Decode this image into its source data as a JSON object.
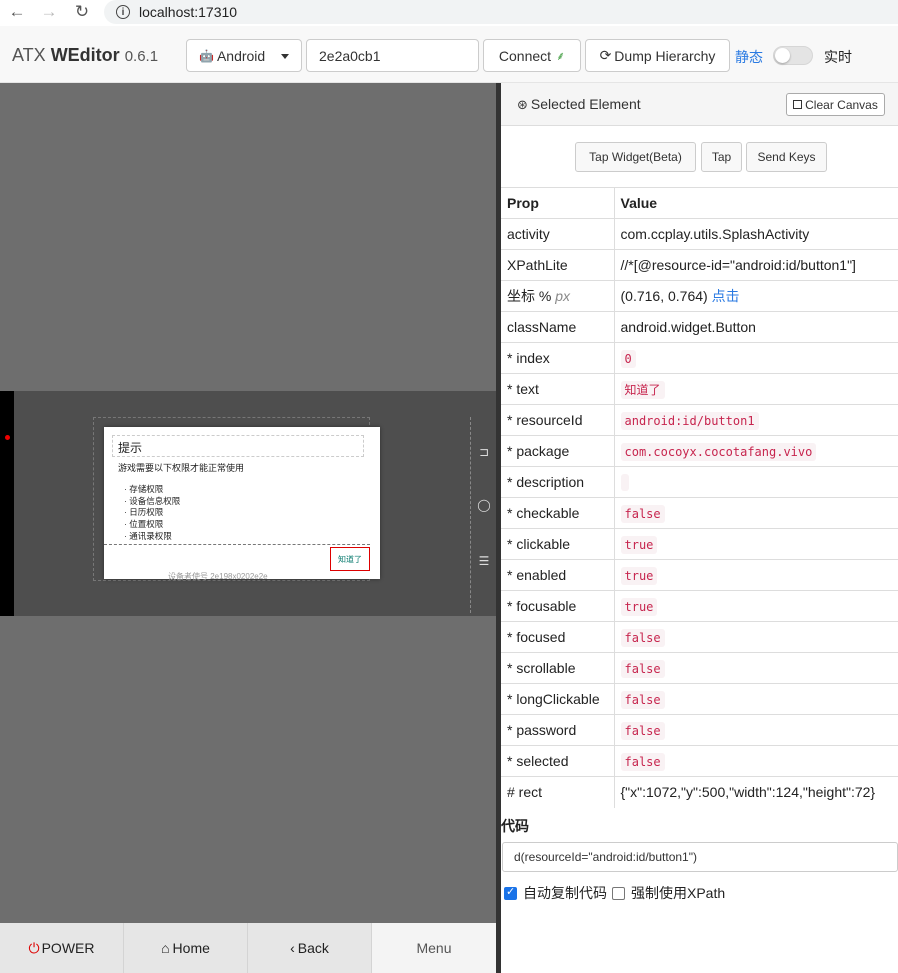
{
  "browser": {
    "url": "localhost:17310"
  },
  "header": {
    "brand_name": "ATX",
    "brand_bold": "WEditor",
    "version": "0.6.1",
    "platform": "Android",
    "serial": "2e2a0cb1",
    "connect_label": "Connect",
    "dump_label": "Dump Hierarchy",
    "static_label": "静态",
    "live_label": "实时"
  },
  "device": {
    "dialog_title": "提示",
    "dialog_message": "游戏需要以下权限才能正常使用",
    "permissions": [
      "存储权限",
      "设备信息权限",
      "日历权限",
      "位置权限",
      "通讯录权限"
    ],
    "ok_label": "知道了",
    "overlay_text": "设备者使号    2e198x0202e2e"
  },
  "bottom_bar": {
    "power": "POWER",
    "home": "Home",
    "back": "Back",
    "menu": "Menu"
  },
  "panel": {
    "title": "Selected Element",
    "clear_canvas": "Clear Canvas",
    "tap_widget": "Tap Widget(Beta)",
    "tap": "Tap",
    "send_keys": "Send Keys",
    "col_prop": "Prop",
    "col_value": "Value",
    "rows": [
      {
        "k": "activity",
        "v": "com.ccplay.utils.SplashActivity"
      },
      {
        "k": "XPathLite",
        "v": "//*[@resource-id=\"android:id/button1\"]"
      },
      {
        "k": "坐标 %",
        "k_suffix": "px",
        "v": "(0.716, 0.764)",
        "v_link": "点击"
      },
      {
        "k": "className",
        "v": "android.widget.Button"
      },
      {
        "k": "* index",
        "v": "0"
      },
      {
        "k": "* text",
        "v": "知道了"
      },
      {
        "k": "* resourceId",
        "v": "android:id/button1"
      },
      {
        "k": "* package",
        "v": "com.cocoyx.cocotafang.vivo"
      },
      {
        "k": "* description",
        "v": ""
      },
      {
        "k": "* checkable",
        "v": "false"
      },
      {
        "k": "* clickable",
        "v": "true"
      },
      {
        "k": "* enabled",
        "v": "true"
      },
      {
        "k": "* focusable",
        "v": "true"
      },
      {
        "k": "* focused",
        "v": "false"
      },
      {
        "k": "* scrollable",
        "v": "false"
      },
      {
        "k": "* longClickable",
        "v": "false"
      },
      {
        "k": "* password",
        "v": "false"
      },
      {
        "k": "* selected",
        "v": "false"
      },
      {
        "k": "# rect",
        "v": "{\"x\":1072,\"y\":500,\"width\":124,\"height\":72}"
      }
    ],
    "code_label": "代码",
    "code": "d(resourceId=\"android:id/button1\")",
    "auto_copy": "自动复制代码",
    "auto_copy_checked": true,
    "force_xpath": "强制使用XPath",
    "force_xpath_checked": false
  },
  "colors": {
    "accent": "#2a7ae2",
    "code_fg": "#c7254e",
    "power_red": "#dd0000"
  }
}
